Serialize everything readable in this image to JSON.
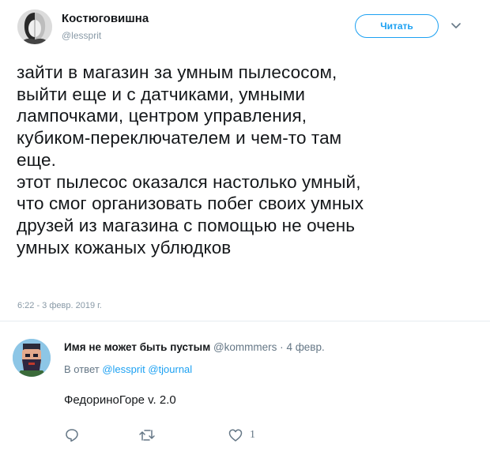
{
  "tweet": {
    "author_name": "Костюговишна",
    "author_handle": "@lessprit",
    "follow_label": "Читать",
    "text": "зайти в магазин за умным пылесосом,\nвыйти еще и с датчиками, умными\nлампочками, центром управления,\nкубиком-переключателем и чем-то там\nеще.\nэтот пылесос оказался настолько умный,\nчто смог организовать побег своих умных\nдрузей из магазина с помощью не очень\nумных кожаных ублюдков",
    "timestamp": "6:22 - 3 февр. 2019 г."
  },
  "reply": {
    "author_name": "Имя не может быть пустым",
    "author_handle": "@kommmers",
    "dot": "·",
    "date": "4 февр.",
    "reply_to_label": "В ответ",
    "mention_1": "@lessprit",
    "mention_2": "@tjournal",
    "text": "ФедориноГоре v. 2.0",
    "like_count": "1"
  },
  "icons": {
    "caret": "chevron-down-icon",
    "reply": "reply-icon",
    "retweet": "retweet-icon",
    "like": "heart-icon"
  },
  "colors": {
    "accent": "#1da1f2",
    "secondary_text": "#657786",
    "divider": "#e6ecf0"
  }
}
